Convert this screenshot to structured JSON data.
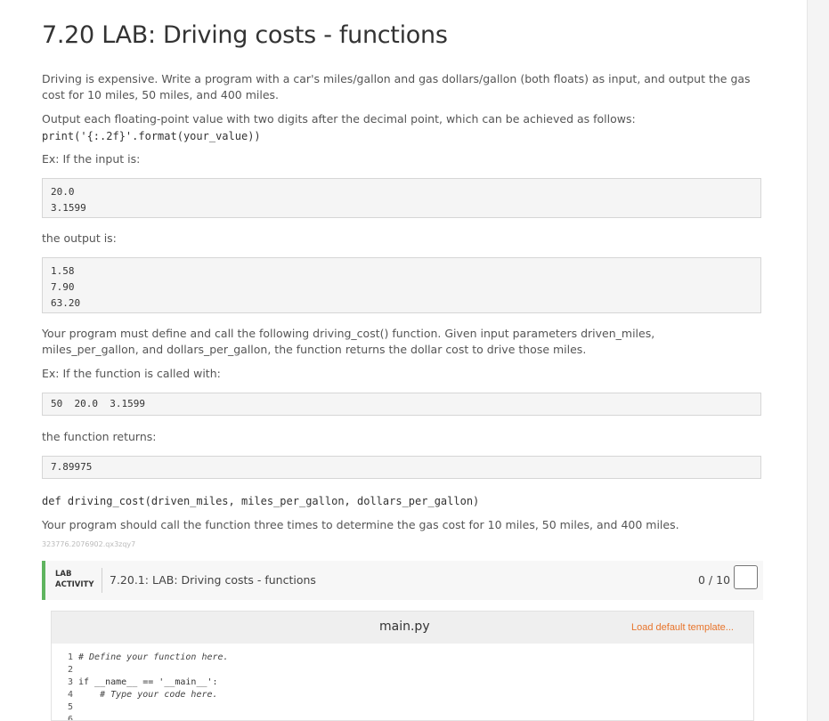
{
  "title": "7.20 LAB: Driving costs - functions",
  "intro": "Driving is expensive. Write a program with a car's miles/gallon and gas dollars/gallon (both floats) as input, and output the gas cost for 10 miles, 50 miles, and 400 miles.",
  "format_text": "Output each floating-point value with two digits after the decimal point, which can be achieved as follows:",
  "format_code": "print('{:.2f}'.format(your_value))",
  "ex_input_label": "Ex: If the input is:",
  "ex_input_lines": [
    "20.0",
    "3.1599"
  ],
  "output_label": "the output is:",
  "output_lines": [
    "1.58",
    "7.90",
    "63.20"
  ],
  "function_text": "Your program must define and call the following driving_cost() function. Given input parameters driven_miles, miles_per_gallon, and dollars_per_gallon, the function returns the dollar cost to drive those miles.",
  "ex_call_label": "Ex: If the function is called with:",
  "call_line": "50  20.0  3.1599",
  "returns_label": "the function returns:",
  "returns_line": "7.89975",
  "signature": "def driving_cost(driven_miles, miles_per_gallon, dollars_per_gallon)",
  "call_three_text": "Your program should call the function three times to determine the gas cost for 10 miles, 50 miles, and 400 miles.",
  "activity_id": "323776.2076902.qx3zqy7",
  "lab": {
    "tag_line1": "LAB",
    "tag_line2": "ACTIVITY",
    "title": "7.20.1: LAB: Driving costs - functions",
    "score": "0 / 10"
  },
  "editor": {
    "filename": "main.py",
    "load_template": "Load default template...",
    "lines": [
      {
        "num": "1",
        "code": "# Define your function here."
      },
      {
        "num": "2",
        "code": ""
      },
      {
        "num": "3",
        "code": "if __name__ == '__main__':"
      },
      {
        "num": "4",
        "code": "    # Type your code here."
      },
      {
        "num": "5",
        "code": ""
      },
      {
        "num": "6",
        "code": ""
      }
    ]
  }
}
